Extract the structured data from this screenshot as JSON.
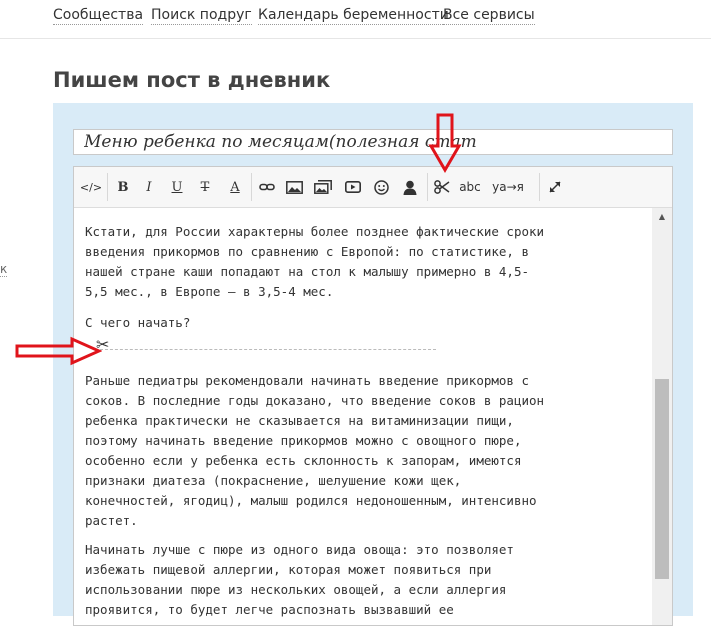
{
  "nav": {
    "items": [
      "Сообщества",
      "Поиск подруг",
      "Календарь беременности",
      "Все сервисы"
    ]
  },
  "side_fragment": "к",
  "page_title": "Пишем пост в дневник",
  "title_input": {
    "value": "Меню ребенка по месяцам(полезная стат"
  },
  "toolbar": {
    "html_label": "</>",
    "bold_label": "B",
    "italic_label": "I",
    "underline_label": "U",
    "strike_label": "T",
    "color_label": "A",
    "spell_label": "abc",
    "translit_label": "уа→я"
  },
  "content": {
    "paragraphs": [
      "Кстати, для России характерны более позднее фактические сроки\nвведения прикормов по сравнению с Европой: по статистике, в\nнашей стране каши попадают на стол к малышу примерно в 4,5-\n5,5 мес., в Европе – в 3,5-4 мес.",
      "С чего начать?",
      "Раньше педиатры рекомендовали начинать введение прикормов с\nсоков. В последние годы доказано, что введение соков в рацион\nребенка практически не сказывается на витаминизации пищи,\nпоэтому начинать введение прикормов можно с овощного пюре,\nособенно если у ребенка есть склонность к запорам, имеются\nпризнаки диатеза (покраснение, шелушение кожи щек,\nконечностей, ягодиц), малыш родился недоношенным, интенсивно\nрастет.",
      "Начинать лучше с пюре из одного вида овоща: это позволяет\nизбежать пищевой аллергии, которая может появиться при\nиспользовании пюре из нескольких овощей, а если аллергия\nпроявится, то будет легче распознать вызвавший ее"
    ]
  },
  "colors": {
    "panel": "#d9ebf7",
    "annotation_arrow": "#e0141b"
  }
}
